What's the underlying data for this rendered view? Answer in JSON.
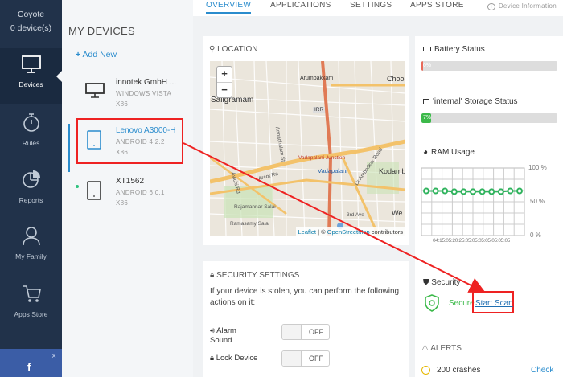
{
  "user": {
    "name": "Coyote",
    "device_count": "0 device(s)"
  },
  "nav": [
    {
      "label": "Devices",
      "icon": "monitor-icon",
      "active": true
    },
    {
      "label": "Rules",
      "icon": "stopwatch-icon"
    },
    {
      "label": "Reports",
      "icon": "pie-chart-icon"
    },
    {
      "label": "My Family",
      "icon": "person-icon"
    },
    {
      "label": "Apps Store",
      "icon": "cart-icon"
    }
  ],
  "facebook": {
    "icon": "facebook-icon",
    "glyph": "f",
    "close": "×"
  },
  "devices_panel": {
    "title": "MY DEVICES",
    "add_new": "Add New",
    "items": [
      {
        "name": "innotek GmbH ...",
        "os": "WINDOWS VISTA",
        "arch": "X86",
        "icon": "monitor-icon"
      },
      {
        "name": "Lenovo A3000-H",
        "os": "ANDROID 4.2.2",
        "arch": "X86",
        "icon": "tablet-icon",
        "selected": true
      },
      {
        "name": "XT1562",
        "os": "ANDROID 6.0.1",
        "arch": "X86",
        "icon": "tablet-icon",
        "online": true
      }
    ]
  },
  "tabs": [
    {
      "label": "OVERVIEW",
      "active": true
    },
    {
      "label": "APPLICATIONS"
    },
    {
      "label": "SETTINGS"
    },
    {
      "label": "APPS STORE"
    },
    {
      "label": "Device Information",
      "icon": "info-icon"
    }
  ],
  "location": {
    "title": "LOCATION",
    "zoom_in": "+",
    "zoom_out": "−",
    "labels": [
      "Arumbakkam",
      "Choo",
      "Saligramam",
      "IRR",
      "Vadapalani Junction",
      "Vadapalani",
      "Kodamb",
      "Arcot Rd",
      "Rajamannar Salai",
      "Ramasamy Salai",
      "Avichi Rd",
      "Annachalam St",
      "Dr Ambedkar Road",
      "3rd Ave",
      "We"
    ],
    "attribution_leaflet": "Leaflet",
    "attribution_sep": " | © ",
    "attribution_osm": "OpenStreetMap",
    "attribution_tail": " contributors"
  },
  "battery": {
    "title": "Battery Status",
    "value_text": "0%",
    "percent": 0
  },
  "storage": {
    "title": "'internal' Storage Status",
    "value_text": "7%",
    "percent": 7
  },
  "ram": {
    "title": "RAM Usage",
    "y_labels": [
      "100 %",
      "50 %",
      "0 %"
    ],
    "x_label": "04:15:05:20:25:05:05:05:05:05:05:05",
    "values_percent": [
      66,
      66,
      66,
      65,
      65,
      65,
      65,
      65,
      65,
      66,
      66
    ]
  },
  "security_settings": {
    "title": "SECURITY SETTINGS",
    "description": "If your device is stolen, you can perform the following actions on it:",
    "alarm_label": "Alarm Sound",
    "alarm_state": "OFF",
    "lock_label": "Lock Device",
    "lock_state": "OFF"
  },
  "security": {
    "title": "Security",
    "status": "Secure",
    "scan_button": "Start Scan"
  },
  "alerts": {
    "title": "ALERTS",
    "crashes": "200 crashes",
    "check": "Check"
  },
  "colors": {
    "accent": "#2a8ccd",
    "nav_bg": "#21324a",
    "ok_green": "#3cb94a",
    "annotation_red": "#e22"
  }
}
